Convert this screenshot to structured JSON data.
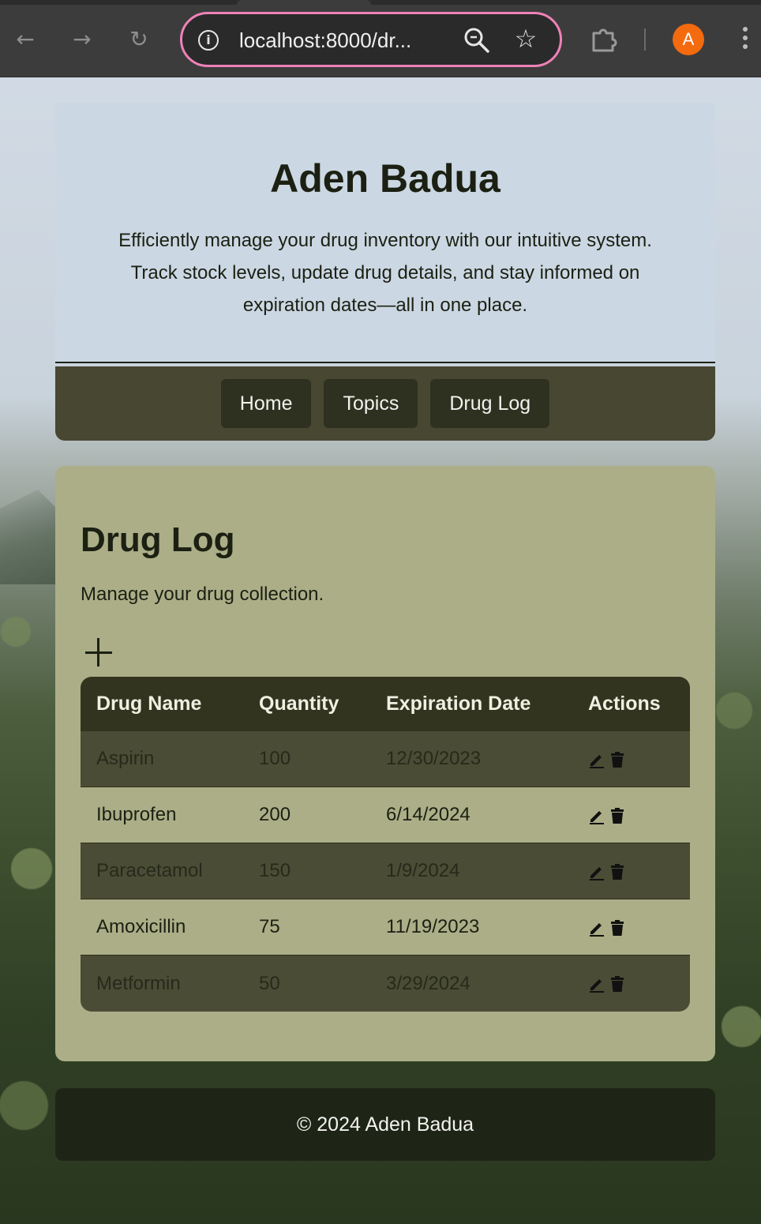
{
  "browser": {
    "url": "localhost:8000/dr...",
    "avatar_letter": "A"
  },
  "header": {
    "title": "Aden Badua",
    "description": "Efficiently manage your drug inventory with our intuitive system. Track stock levels, update drug details, and stay informed on expiration dates—all in one place."
  },
  "nav": {
    "items": [
      {
        "label": "Home"
      },
      {
        "label": "Topics"
      },
      {
        "label": "Drug Log"
      }
    ]
  },
  "main": {
    "title": "Drug Log",
    "subtitle": "Manage your drug collection.",
    "add_icon": "plus-icon",
    "table": {
      "headers": [
        "Drug Name",
        "Quantity",
        "Expiration Date",
        "Actions"
      ],
      "rows": [
        {
          "name": "Aspirin",
          "quantity": "100",
          "expiration": "12/30/2023"
        },
        {
          "name": "Ibuprofen",
          "quantity": "200",
          "expiration": "6/14/2024"
        },
        {
          "name": "Paracetamol",
          "quantity": "150",
          "expiration": "1/9/2024"
        },
        {
          "name": "Amoxicillin",
          "quantity": "75",
          "expiration": "11/19/2023"
        },
        {
          "name": "Metformin",
          "quantity": "50",
          "expiration": "3/29/2024"
        }
      ],
      "row_actions": [
        "edit-icon",
        "trash-icon"
      ]
    }
  },
  "footer": {
    "text": "© 2024 Aden Badua"
  },
  "colors": {
    "accent": "#474732",
    "card": "#abae87",
    "header_bg": "#cbd7e3",
    "avatar": "#f46a0e",
    "omnibox_focus": "#ee82b8"
  }
}
